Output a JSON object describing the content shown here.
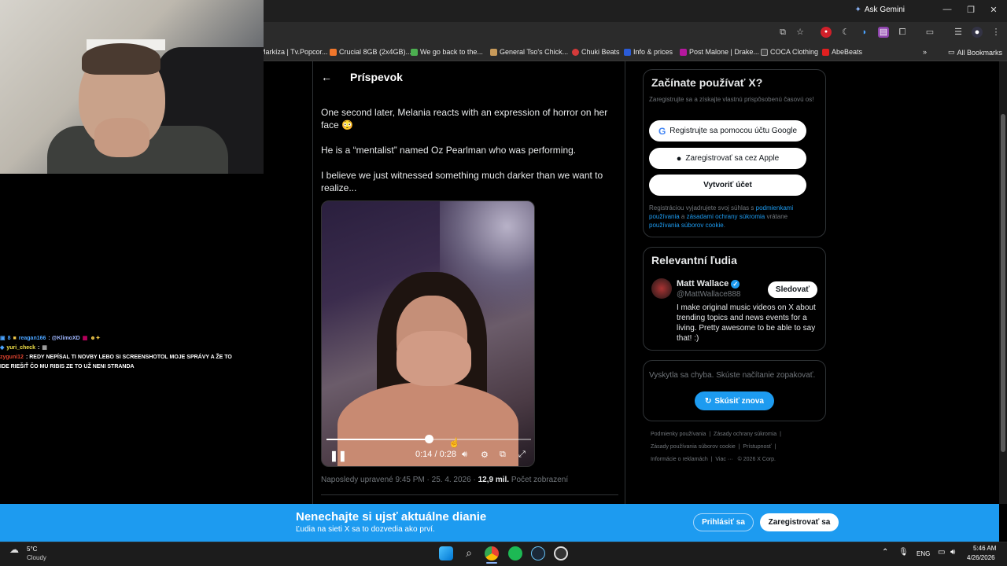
{
  "browser": {
    "ask_gemini": "Ask Gemini",
    "bookmarks": [
      {
        "label": "Markíza | Tv.Popcor...",
        "color": "#e03a3a"
      },
      {
        "label": "Crucial 8GB (2x4GB)...",
        "color": "#f0762b"
      },
      {
        "label": "We go back to the...",
        "color": "#4caf50"
      },
      {
        "label": "General Tso's Chick...",
        "color": "#c89a5a"
      },
      {
        "label": "Chuki Beats",
        "color": "#d43a3a"
      },
      {
        "label": "Info & prices",
        "color": "#2a5bd7"
      },
      {
        "label": "Post Malone | Drake...",
        "color": "#b5179e"
      },
      {
        "label": "COCA Clothing",
        "color": "#444444"
      },
      {
        "label": "AbeBeats",
        "color": "#e02020"
      }
    ],
    "all_bookmarks": "All Bookmarks"
  },
  "chat": [
    {
      "user": "reagan166",
      "user_color": "#4aa3ff",
      "prefix": "8",
      "message": ": @KlimoXD",
      "msg_color": "#9fb7ff"
    },
    {
      "user": "yuri_check",
      "user_color": "#f2e24a",
      "prefix": "",
      "message": ":",
      "msg_color": "#ffffff"
    },
    {
      "user": "zyguni12",
      "user_color": "#e0442f",
      "prefix": "",
      "message": ": REDY NEPÍSAL TI NOVBY LEBO SI SCREENSHOTOL MOJE SPRÁVY A ŽE TO",
      "msg_color": "#ffffff"
    },
    {
      "user": "",
      "user_color": "#ffffff",
      "prefix": "",
      "message": "IDE RIEŠIŤ ČO MU RIBIS ZE TO UŽ NENI STRANDA",
      "msg_color": "#ffffff"
    }
  ],
  "post": {
    "title": "Príspevok",
    "paragraphs": [
      "One second later, Melania reacts with an expression of horror on her face 😳",
      "He is a “mentalist” named Oz Pearlman who was performing.",
      "I believe we just witnessed something much darker than we want to realize..."
    ],
    "video_time": "0:14 / 0:28",
    "video_progress": 0.5,
    "meta_prefix": "Naposledy upravené 9:45 PM · 25. 4. 2026 · ",
    "meta_views_count": "12,9 mil.",
    "meta_views_label": "Počet zobrazení"
  },
  "signup": {
    "title": "Začínate používať X?",
    "subtitle": "Zaregistrujte sa a získajte vlastnú prispôsobenú časovú os!",
    "google_btn": "Registrujte sa pomocou účtu Google",
    "apple_btn": "Zaregistrovať sa cez Apple",
    "create_btn": "Vytvoriť účet",
    "legal_1": "Registráciou vyjadrujete svoj súhlas s ",
    "legal_link_1": "podmienkami používania",
    "legal_2": " a ",
    "legal_link_2": "zásadami ochrany súkromia",
    "legal_3": " vrátane ",
    "legal_link_3": "používania súborov cookie",
    "legal_4": "."
  },
  "people": {
    "title": "Relevantní ľudia",
    "name": "Matt Wallace",
    "handle": "@MattWallace888",
    "follow_btn": "Sledovať",
    "bio": "I make original music videos on X about trending topics and news events for a living. Pretty awesome to be able to say that! :)"
  },
  "error": {
    "message": "Vyskytla sa chyba. Skúste načítanie zopakovať.",
    "retry_btn": "Skúsiť znova"
  },
  "footer": {
    "row1": [
      "Podmienky používania",
      "Zásady ochrany súkromia"
    ],
    "row2": [
      "Zásady používania súborov cookie",
      "Prístupnosť"
    ],
    "row3": [
      "Informácie o reklamách",
      "Viac ···",
      "© 2026 X Corp."
    ]
  },
  "banner": {
    "title": "Nenechajte si ujsť aktuálne dianie",
    "subtitle": "Ľudia na sieti X sa to dozvedia ako prví.",
    "login_btn": "Prihlásiť sa",
    "register_btn": "Zaregistrovať sa"
  },
  "taskbar": {
    "weather_temp": "5°C",
    "weather_desc": "Cloudy",
    "lang": "ENG",
    "time": "5:46 AM",
    "date": "4/26/2026"
  },
  "colors": {
    "accent": "#1d9bf0",
    "background": "#000000",
    "text": "#e7e9ea",
    "muted": "#71767b"
  }
}
